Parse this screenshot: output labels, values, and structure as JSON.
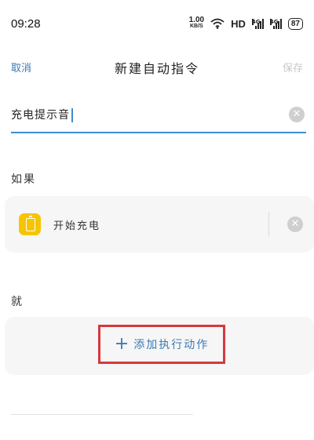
{
  "status_bar": {
    "time": "09:28",
    "net_speed_value": "1.00",
    "net_speed_unit": "KB/S",
    "hd_label": "HD",
    "signal1_label": "4G",
    "signal2_label": "4G",
    "battery": "87"
  },
  "header": {
    "cancel_label": "取消",
    "title": "新建自动指令",
    "save_label": "保存"
  },
  "name_input": {
    "value": "充电提示音"
  },
  "condition_section": {
    "label": "如果",
    "items": [
      {
        "label": "开始充电",
        "icon": "battery-charging-icon",
        "icon_color": "#f6c400"
      }
    ]
  },
  "action_section": {
    "label": "就",
    "add_action_label": "添加执行动作"
  },
  "colors": {
    "accent": "#3a79b7",
    "input_underline": "#3a8fd6",
    "highlight_border": "#d6393d",
    "card_bg": "#f6f6f6"
  }
}
